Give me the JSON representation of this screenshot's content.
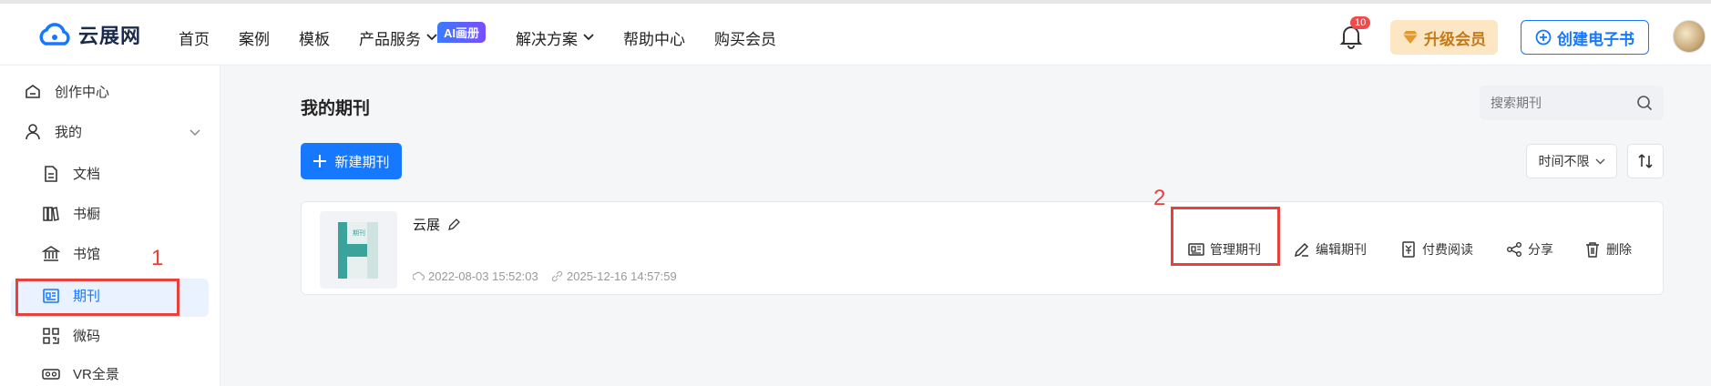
{
  "header": {
    "logo_text": "云展网",
    "nav": [
      {
        "label": "首页"
      },
      {
        "label": "案例"
      },
      {
        "label": "模板"
      },
      {
        "label": "产品服务"
      },
      {
        "label": "解决方案"
      },
      {
        "label": "帮助中心"
      },
      {
        "label": "购买会员"
      }
    ],
    "ai_badge": "AI画册",
    "notification_count": "10",
    "upgrade_label": "升级会员",
    "create_label": "创建电子书"
  },
  "sidebar": {
    "items": [
      {
        "label": "创作中心",
        "icon": "home-icon"
      },
      {
        "label": "我的",
        "icon": "user-icon"
      },
      {
        "label": "文档",
        "icon": "document-icon"
      },
      {
        "label": "书橱",
        "icon": "bookshelf-icon"
      },
      {
        "label": "书馆",
        "icon": "library-icon"
      },
      {
        "label": "期刊",
        "icon": "journal-icon"
      },
      {
        "label": "微码",
        "icon": "qrcode-icon"
      },
      {
        "label": "VR全景",
        "icon": "vr-icon"
      }
    ],
    "active_item": "期刊"
  },
  "main": {
    "title": "我的期刊",
    "search_placeholder": "搜索期刊",
    "new_button": "新建期刊",
    "time_filter": "时间不限",
    "journal": {
      "name": "云展",
      "thumbnail_label": "期刊",
      "created": "2022-08-03 15:52:03",
      "updated": "2025-12-16 14:57:59",
      "actions": [
        "管理期刊",
        "编辑期刊",
        "付费阅读",
        "分享",
        "删除"
      ]
    }
  },
  "annotations": [
    "1",
    "2"
  ],
  "colors": {
    "accent": "#1677ff",
    "annotation": "#e8413c",
    "vip": "#c47a18"
  }
}
